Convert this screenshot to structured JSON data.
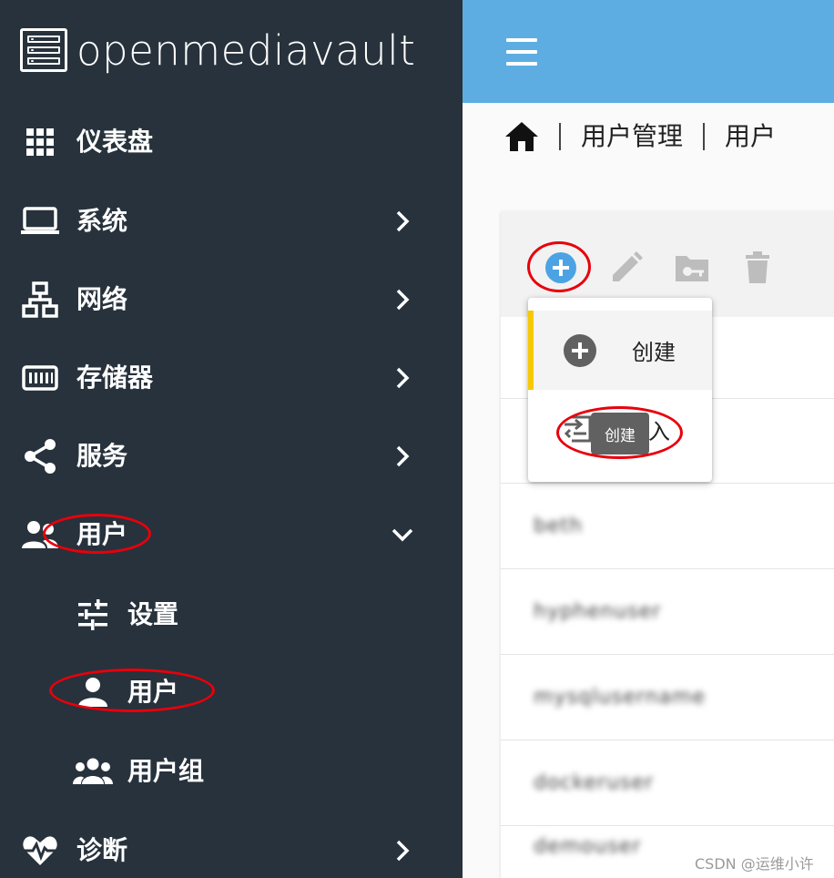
{
  "app": {
    "brand_name": "openmediavault"
  },
  "sidebar": {
    "items": [
      {
        "label": "仪表盘",
        "icon": "dashboard-grid-icon"
      },
      {
        "label": "系统",
        "icon": "laptop-icon"
      },
      {
        "label": "网络",
        "icon": "network-icon"
      },
      {
        "label": "存储器",
        "icon": "storage-icon"
      },
      {
        "label": "服务",
        "icon": "share-icon"
      },
      {
        "label": "用户",
        "icon": "users-icon",
        "expanded": true
      },
      {
        "label": "诊断",
        "icon": "heartbeat-icon"
      }
    ],
    "sub_items": [
      {
        "label": "设置",
        "icon": "sliders-icon"
      },
      {
        "label": "用户",
        "icon": "user-icon",
        "selected": true
      },
      {
        "label": "用户组",
        "icon": "group-icon"
      }
    ]
  },
  "breadcrumb": {
    "items": [
      "用户管理",
      "用户"
    ]
  },
  "toolbar": {
    "buttons": [
      "add-icon",
      "edit-icon",
      "folder-key-icon",
      "delete-icon"
    ]
  },
  "add_menu": {
    "items": [
      {
        "label": "创建",
        "icon": "add-circle-icon",
        "active": true
      },
      {
        "label": "导入",
        "icon": "import-icon"
      }
    ],
    "tooltip": "创建"
  },
  "user_list": {
    "rows": [
      "beth",
      "hyphenuser",
      "mysqlusername",
      "dockeruser",
      "demouser"
    ]
  },
  "watermark": "CSDN @运维小许",
  "colors": {
    "sidebar_bg": "#27323c",
    "topbar_bg": "#5dade2",
    "accent_yellow": "#f6c900",
    "annotation_red": "#e8000b",
    "add_button_blue": "#4ba3e3"
  }
}
